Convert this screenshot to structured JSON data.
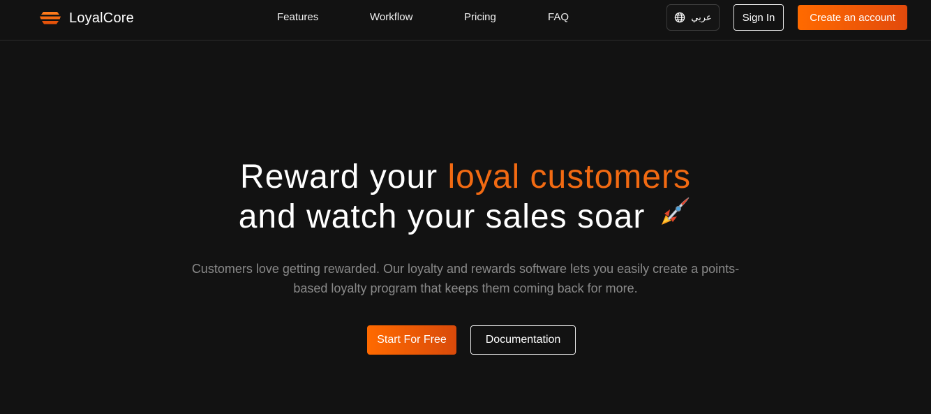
{
  "brand": {
    "name": "LoyalCore",
    "logo_icon": "stacked-layers-logo-icon"
  },
  "nav": {
    "items": [
      {
        "label": "Features"
      },
      {
        "label": "Workflow"
      },
      {
        "label": "Pricing"
      },
      {
        "label": "FAQ"
      }
    ]
  },
  "header_actions": {
    "language_label": "عربي",
    "language_icon": "globe-icon",
    "sign_in_label": "Sign In",
    "create_account_label": "Create an account"
  },
  "hero": {
    "title_part1": "Reward your ",
    "title_accent": "loyal customers",
    "title_line2": "and watch your sales soar",
    "title_icon": "rocket-icon",
    "subtitle_line1": "Customers love getting rewarded. Our loyalty and rewards software lets you easily create a points-",
    "subtitle_line2": "based loyalty program that keeps them coming back for more.",
    "primary_cta": "Start For Free",
    "secondary_cta": "Documentation"
  },
  "colors": {
    "background": "#121212",
    "accent": "#f26a12",
    "text": "#ffffff",
    "muted_text": "#8a8a8a",
    "border": "#2d2d2d"
  }
}
